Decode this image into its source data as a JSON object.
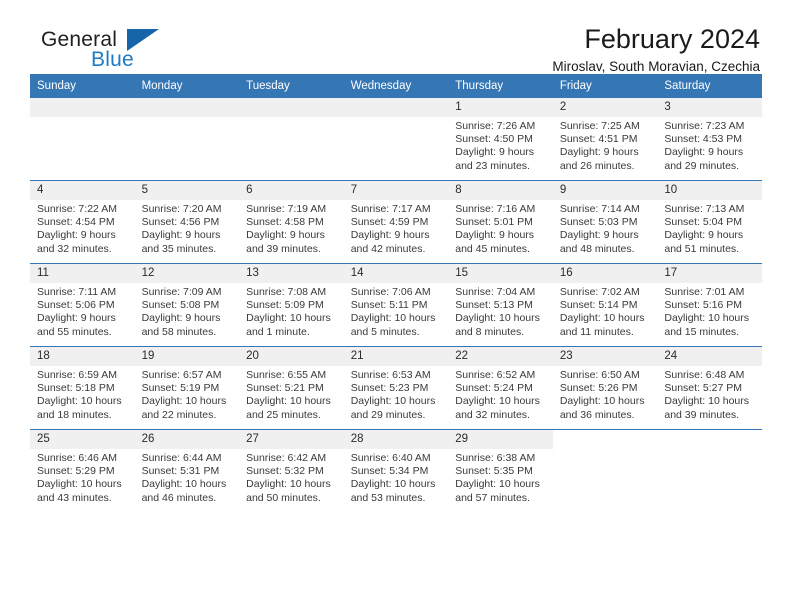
{
  "brand": {
    "name_part1": "General",
    "name_part2": "Blue",
    "accent_color": "#1565a8",
    "text_color": "#231f20"
  },
  "header": {
    "title": "February 2024",
    "subtitle": "Miroslav, South Moravian, Czechia",
    "header_bg": "#3576b5"
  },
  "weekdays": [
    "Sunday",
    "Monday",
    "Tuesday",
    "Wednesday",
    "Thursday",
    "Friday",
    "Saturday"
  ],
  "labels": {
    "sunrise": "Sunrise:",
    "sunset": "Sunset:",
    "daylight": "Daylight:"
  },
  "weeks": [
    [
      {
        "type": "empty"
      },
      {
        "type": "empty"
      },
      {
        "type": "empty"
      },
      {
        "type": "empty"
      },
      {
        "type": "day",
        "day": "1",
        "sunrise": "Sunrise: 7:26 AM",
        "sunset": "Sunset: 4:50 PM",
        "daylight_line1": "Daylight: 9 hours",
        "daylight_line2": "and 23 minutes."
      },
      {
        "type": "day",
        "day": "2",
        "sunrise": "Sunrise: 7:25 AM",
        "sunset": "Sunset: 4:51 PM",
        "daylight_line1": "Daylight: 9 hours",
        "daylight_line2": "and 26 minutes."
      },
      {
        "type": "day",
        "day": "3",
        "sunrise": "Sunrise: 7:23 AM",
        "sunset": "Sunset: 4:53 PM",
        "daylight_line1": "Daylight: 9 hours",
        "daylight_line2": "and 29 minutes."
      }
    ],
    [
      {
        "type": "day",
        "day": "4",
        "sunrise": "Sunrise: 7:22 AM",
        "sunset": "Sunset: 4:54 PM",
        "daylight_line1": "Daylight: 9 hours",
        "daylight_line2": "and 32 minutes."
      },
      {
        "type": "day",
        "day": "5",
        "sunrise": "Sunrise: 7:20 AM",
        "sunset": "Sunset: 4:56 PM",
        "daylight_line1": "Daylight: 9 hours",
        "daylight_line2": "and 35 minutes."
      },
      {
        "type": "day",
        "day": "6",
        "sunrise": "Sunrise: 7:19 AM",
        "sunset": "Sunset: 4:58 PM",
        "daylight_line1": "Daylight: 9 hours",
        "daylight_line2": "and 39 minutes."
      },
      {
        "type": "day",
        "day": "7",
        "sunrise": "Sunrise: 7:17 AM",
        "sunset": "Sunset: 4:59 PM",
        "daylight_line1": "Daylight: 9 hours",
        "daylight_line2": "and 42 minutes."
      },
      {
        "type": "day",
        "day": "8",
        "sunrise": "Sunrise: 7:16 AM",
        "sunset": "Sunset: 5:01 PM",
        "daylight_line1": "Daylight: 9 hours",
        "daylight_line2": "and 45 minutes."
      },
      {
        "type": "day",
        "day": "9",
        "sunrise": "Sunrise: 7:14 AM",
        "sunset": "Sunset: 5:03 PM",
        "daylight_line1": "Daylight: 9 hours",
        "daylight_line2": "and 48 minutes."
      },
      {
        "type": "day",
        "day": "10",
        "sunrise": "Sunrise: 7:13 AM",
        "sunset": "Sunset: 5:04 PM",
        "daylight_line1": "Daylight: 9 hours",
        "daylight_line2": "and 51 minutes."
      }
    ],
    [
      {
        "type": "day",
        "day": "11",
        "sunrise": "Sunrise: 7:11 AM",
        "sunset": "Sunset: 5:06 PM",
        "daylight_line1": "Daylight: 9 hours",
        "daylight_line2": "and 55 minutes."
      },
      {
        "type": "day",
        "day": "12",
        "sunrise": "Sunrise: 7:09 AM",
        "sunset": "Sunset: 5:08 PM",
        "daylight_line1": "Daylight: 9 hours",
        "daylight_line2": "and 58 minutes."
      },
      {
        "type": "day",
        "day": "13",
        "sunrise": "Sunrise: 7:08 AM",
        "sunset": "Sunset: 5:09 PM",
        "daylight_line1": "Daylight: 10 hours",
        "daylight_line2": "and 1 minute."
      },
      {
        "type": "day",
        "day": "14",
        "sunrise": "Sunrise: 7:06 AM",
        "sunset": "Sunset: 5:11 PM",
        "daylight_line1": "Daylight: 10 hours",
        "daylight_line2": "and 5 minutes."
      },
      {
        "type": "day",
        "day": "15",
        "sunrise": "Sunrise: 7:04 AM",
        "sunset": "Sunset: 5:13 PM",
        "daylight_line1": "Daylight: 10 hours",
        "daylight_line2": "and 8 minutes."
      },
      {
        "type": "day",
        "day": "16",
        "sunrise": "Sunrise: 7:02 AM",
        "sunset": "Sunset: 5:14 PM",
        "daylight_line1": "Daylight: 10 hours",
        "daylight_line2": "and 11 minutes."
      },
      {
        "type": "day",
        "day": "17",
        "sunrise": "Sunrise: 7:01 AM",
        "sunset": "Sunset: 5:16 PM",
        "daylight_line1": "Daylight: 10 hours",
        "daylight_line2": "and 15 minutes."
      }
    ],
    [
      {
        "type": "day",
        "day": "18",
        "sunrise": "Sunrise: 6:59 AM",
        "sunset": "Sunset: 5:18 PM",
        "daylight_line1": "Daylight: 10 hours",
        "daylight_line2": "and 18 minutes."
      },
      {
        "type": "day",
        "day": "19",
        "sunrise": "Sunrise: 6:57 AM",
        "sunset": "Sunset: 5:19 PM",
        "daylight_line1": "Daylight: 10 hours",
        "daylight_line2": "and 22 minutes."
      },
      {
        "type": "day",
        "day": "20",
        "sunrise": "Sunrise: 6:55 AM",
        "sunset": "Sunset: 5:21 PM",
        "daylight_line1": "Daylight: 10 hours",
        "daylight_line2": "and 25 minutes."
      },
      {
        "type": "day",
        "day": "21",
        "sunrise": "Sunrise: 6:53 AM",
        "sunset": "Sunset: 5:23 PM",
        "daylight_line1": "Daylight: 10 hours",
        "daylight_line2": "and 29 minutes."
      },
      {
        "type": "day",
        "day": "22",
        "sunrise": "Sunrise: 6:52 AM",
        "sunset": "Sunset: 5:24 PM",
        "daylight_line1": "Daylight: 10 hours",
        "daylight_line2": "and 32 minutes."
      },
      {
        "type": "day",
        "day": "23",
        "sunrise": "Sunrise: 6:50 AM",
        "sunset": "Sunset: 5:26 PM",
        "daylight_line1": "Daylight: 10 hours",
        "daylight_line2": "and 36 minutes."
      },
      {
        "type": "day",
        "day": "24",
        "sunrise": "Sunrise: 6:48 AM",
        "sunset": "Sunset: 5:27 PM",
        "daylight_line1": "Daylight: 10 hours",
        "daylight_line2": "and 39 minutes."
      }
    ],
    [
      {
        "type": "day",
        "day": "25",
        "sunrise": "Sunrise: 6:46 AM",
        "sunset": "Sunset: 5:29 PM",
        "daylight_line1": "Daylight: 10 hours",
        "daylight_line2": "and 43 minutes."
      },
      {
        "type": "day",
        "day": "26",
        "sunrise": "Sunrise: 6:44 AM",
        "sunset": "Sunset: 5:31 PM",
        "daylight_line1": "Daylight: 10 hours",
        "daylight_line2": "and 46 minutes."
      },
      {
        "type": "day",
        "day": "27",
        "sunrise": "Sunrise: 6:42 AM",
        "sunset": "Sunset: 5:32 PM",
        "daylight_line1": "Daylight: 10 hours",
        "daylight_line2": "and 50 minutes."
      },
      {
        "type": "day",
        "day": "28",
        "sunrise": "Sunrise: 6:40 AM",
        "sunset": "Sunset: 5:34 PM",
        "daylight_line1": "Daylight: 10 hours",
        "daylight_line2": "and 53 minutes."
      },
      {
        "type": "day",
        "day": "29",
        "sunrise": "Sunrise: 6:38 AM",
        "sunset": "Sunset: 5:35 PM",
        "daylight_line1": "Daylight: 10 hours",
        "daylight_line2": "and 57 minutes."
      },
      {
        "type": "blank"
      },
      {
        "type": "blank"
      }
    ]
  ]
}
